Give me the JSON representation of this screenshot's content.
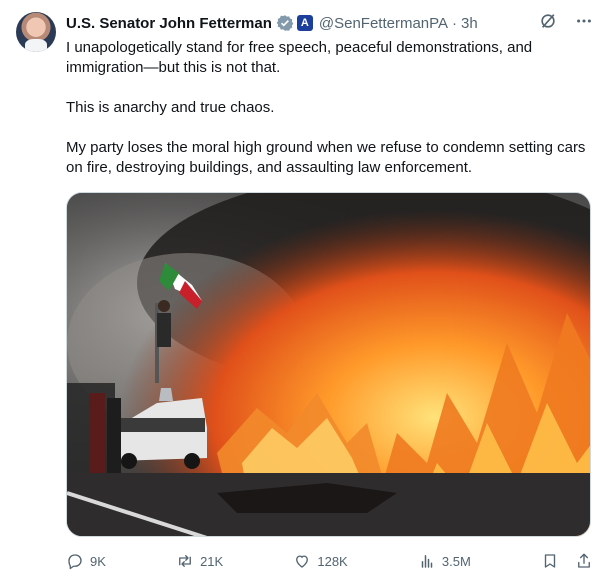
{
  "author": {
    "name": "U.S. Senator John Fetterman",
    "handle": "@SenFettermanPA",
    "separator": "·",
    "time": "3h",
    "affiliation_badge_text": "A"
  },
  "tweet": {
    "paragraphs": [
      "I unapologetically stand for free speech, peaceful demonstrations, and immigration—but this is not that.",
      "This is anarchy and true chaos.",
      "My party loses the moral high ground when we refuse to condemn setting cars on fire, destroying buildings, and assaulting law enforcement."
    ]
  },
  "metrics": {
    "replies": "9K",
    "reposts": "21K",
    "likes": "128K",
    "views": "3.5M"
  },
  "icons": {
    "verified": "verified-badge-icon",
    "affiliation": "government-affiliation-icon",
    "grok": "grok-icon",
    "more": "more-icon",
    "reply": "reply-icon",
    "repost": "repost-icon",
    "like": "like-icon",
    "views": "views-icon",
    "bookmark": "bookmark-icon",
    "share": "share-icon"
  },
  "colors": {
    "text": "#0f1419",
    "muted": "#536471",
    "verified_badge": "#829aab",
    "affiliation_badge": "#1d3f9c"
  }
}
